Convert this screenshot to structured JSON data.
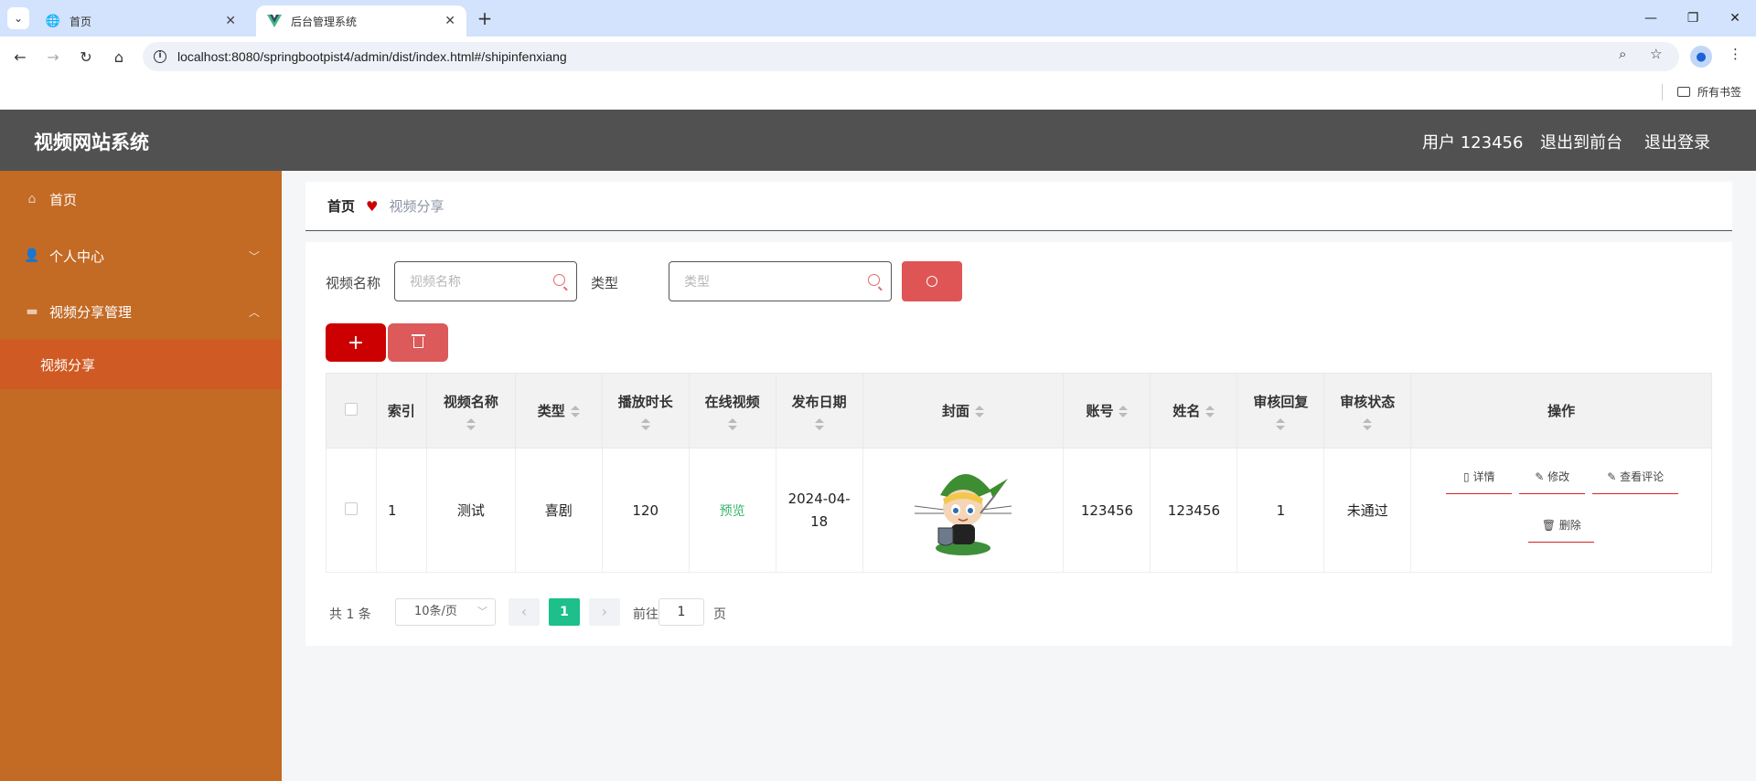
{
  "browser": {
    "tabs": [
      {
        "title": "首页",
        "active": false
      },
      {
        "title": "后台管理系统",
        "active": true
      }
    ],
    "url": "localhost:8080/springbootpist4/admin/dist/index.html#/shipinfenxiang",
    "bookmarks_label": "所有书签"
  },
  "header": {
    "app_title": "视频网站系统",
    "user_label": "用户 123456",
    "to_front_label": "退出到前台",
    "logout_label": "退出登录"
  },
  "sidebar": {
    "items": [
      {
        "label": "首页",
        "icon": "home-icon"
      },
      {
        "label": "个人中心",
        "icon": "user-icon"
      },
      {
        "label": "视频分享管理",
        "icon": "monitor-icon"
      }
    ],
    "sub_item": "视频分享"
  },
  "breadcrumb": {
    "home": "首页",
    "current": "视频分享"
  },
  "search": {
    "name_label": "视频名称",
    "name_placeholder": "视频名称",
    "type_label": "类型",
    "type_placeholder": "类型"
  },
  "table": {
    "headers": [
      "索引",
      "视频名称",
      "类型",
      "播放时长",
      "在线视频",
      "发布日期",
      "封面",
      "账号",
      "姓名",
      "审核回复",
      "审核状态",
      "操作"
    ],
    "rows": [
      {
        "index": "1",
        "name": "测试",
        "type": "喜剧",
        "duration": "120",
        "online": "预览",
        "date": "2024-04-18",
        "account": "123456",
        "realname": "123456",
        "reply": "1",
        "status": "未通过"
      }
    ],
    "actions": {
      "detail": "详情",
      "edit": "修改",
      "comments": "查看评论",
      "delete": "删除"
    }
  },
  "pagination": {
    "total": "共 1 条",
    "page_size": "10条/页",
    "current_page": "1",
    "goto_label": "前往",
    "goto_value": "1",
    "page_suffix": "页"
  },
  "colors": {
    "header_bg": "#515151",
    "sidebar_bg": "#c36a24",
    "sidebar_active": "#cf5a23",
    "primary_red": "#cc0000",
    "pager_active": "#1dbf8a"
  }
}
